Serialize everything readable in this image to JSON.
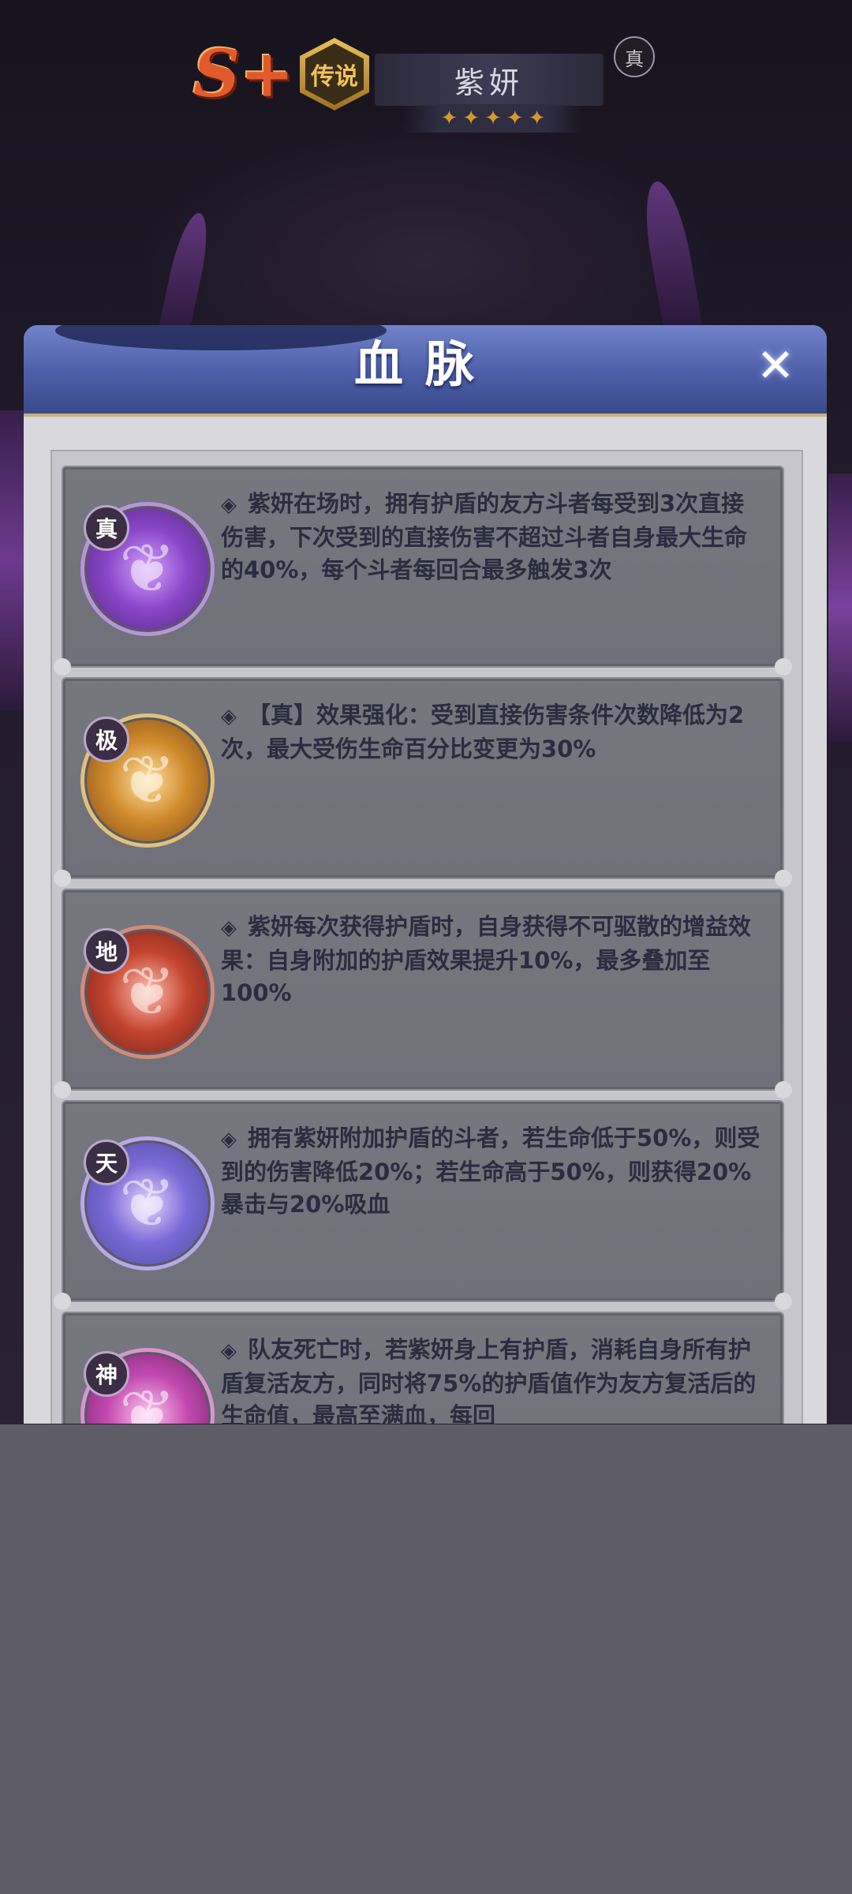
{
  "hero": {
    "rank": "S+",
    "rarity": "传说",
    "name": "紫妍",
    "star_count": 5,
    "tag": "真"
  },
  "dialog": {
    "title": "血脉",
    "close_icon": "close-icon"
  },
  "abilities": [
    {
      "grade": "真",
      "text": "紫妍在场时，拥有护盾的友方斗者每受到3次直接伤害，下次受到的直接伤害不超过斗者自身最大生命的40%，每个斗者每回合最多触发3次",
      "emblem_color": "#8a47c9"
    },
    {
      "grade": "极",
      "text": "【真】效果强化：受到直接伤害条件次数降低为2次，最大受伤生命百分比变更为30%",
      "emblem_color": "#d08a2c"
    },
    {
      "grade": "地",
      "text": "紫妍每次获得护盾时，自身获得不可驱散的增益效果：自身附加的护盾效果提升10%，最多叠加至100%",
      "emblem_color": "#c4452f"
    },
    {
      "grade": "天",
      "text": "拥有紫妍附加护盾的斗者，若生命低于50%，则受到的伤害降低20%；若生命高于50%，则获得20%暴击与20%吸血",
      "emblem_color": "#7a6ad6"
    },
    {
      "grade": "神",
      "text": "队友死亡时，若紫妍身上有护盾，消耗自身所有护盾复活友方，同时将75%的护盾值作为友方复活后的生命值，最高至满血，每回",
      "emblem_color": "#c34ab0"
    }
  ]
}
